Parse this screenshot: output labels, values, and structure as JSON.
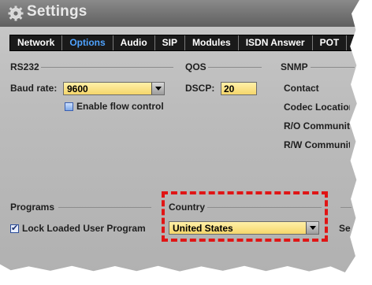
{
  "window": {
    "title": "Settings"
  },
  "tabs": [
    {
      "label": "Network",
      "active": false
    },
    {
      "label": "Options",
      "active": true
    },
    {
      "label": "Audio",
      "active": false
    },
    {
      "label": "SIP",
      "active": false
    },
    {
      "label": "Modules",
      "active": false
    },
    {
      "label": "ISDN Answer",
      "active": false
    },
    {
      "label": "POT",
      "active": false
    }
  ],
  "rs232": {
    "heading": "RS232",
    "baud_label": "Baud rate:",
    "baud_value": "9600",
    "flow_control_label": "Enable flow control",
    "flow_control_checked": false
  },
  "qos": {
    "heading": "QOS",
    "dscp_label": "DSCP:",
    "dscp_value": "20"
  },
  "snmp": {
    "heading": "SNMP",
    "items": [
      "Contact",
      "Codec Location",
      "R/O Community",
      "R/W Community"
    ]
  },
  "programs": {
    "heading": "Programs",
    "lock_label": "Lock Loaded User Program",
    "lock_checked": true
  },
  "country": {
    "heading": "Country",
    "value": "United States"
  },
  "right_partial": {
    "label": "Se"
  },
  "colors": {
    "accent_tab": "#4fa3ff",
    "field_bg": "#f5d66b",
    "highlight": "#e01515"
  }
}
